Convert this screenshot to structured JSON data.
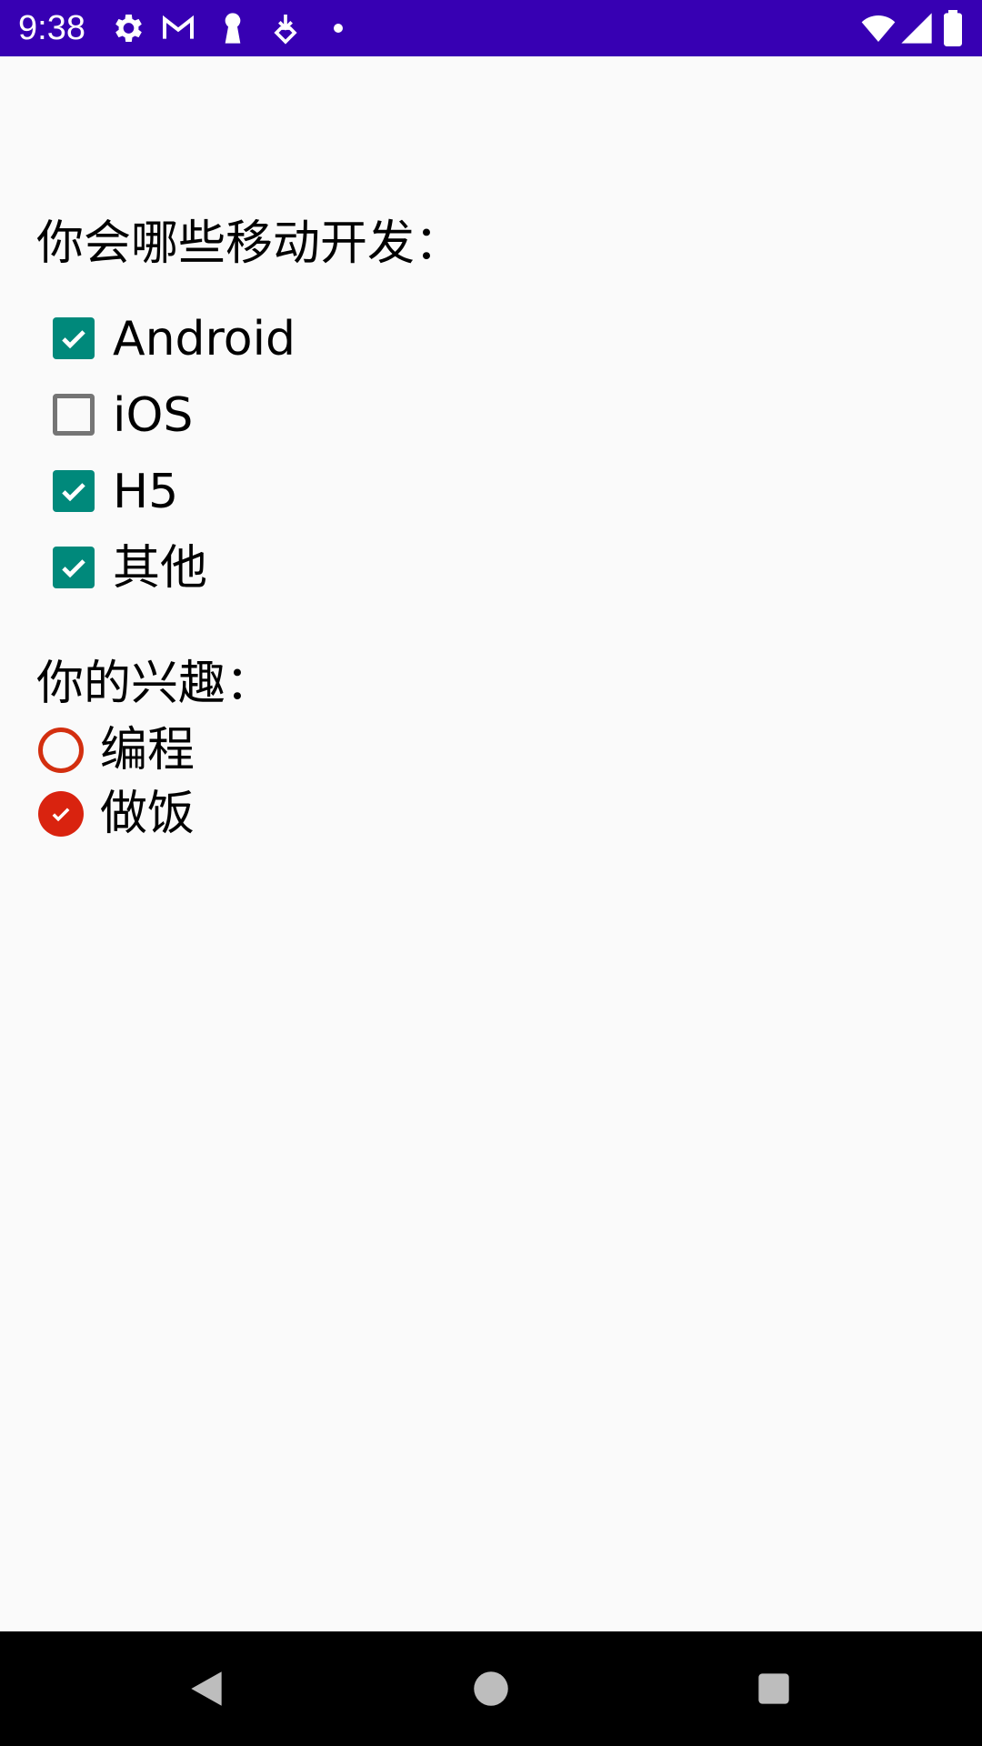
{
  "status_bar": {
    "time": "9:38",
    "icons": [
      "settings-icon",
      "gmail-icon",
      "keyhole-icon",
      "download-icon",
      "dot-icon",
      "wifi-icon",
      "signal-icon",
      "battery-icon"
    ],
    "background": "#3700b3"
  },
  "main": {
    "question_title": "你会哪些移动开发：",
    "checkboxes": [
      {
        "label": "Android",
        "checked": true
      },
      {
        "label": "iOS",
        "checked": false
      },
      {
        "label": "H5",
        "checked": true
      },
      {
        "label": "其他",
        "checked": true
      }
    ],
    "interest_title": "你的兴趣：",
    "radios": [
      {
        "label": "编程",
        "checked": false
      },
      {
        "label": "做饭",
        "checked": true
      }
    ]
  },
  "colors": {
    "checkbox_accent": "#00897b",
    "radio_accent": "#d9230f",
    "background": "#fafafa"
  },
  "nav_bar": {
    "buttons": [
      "back-icon",
      "home-icon",
      "recents-icon"
    ]
  }
}
